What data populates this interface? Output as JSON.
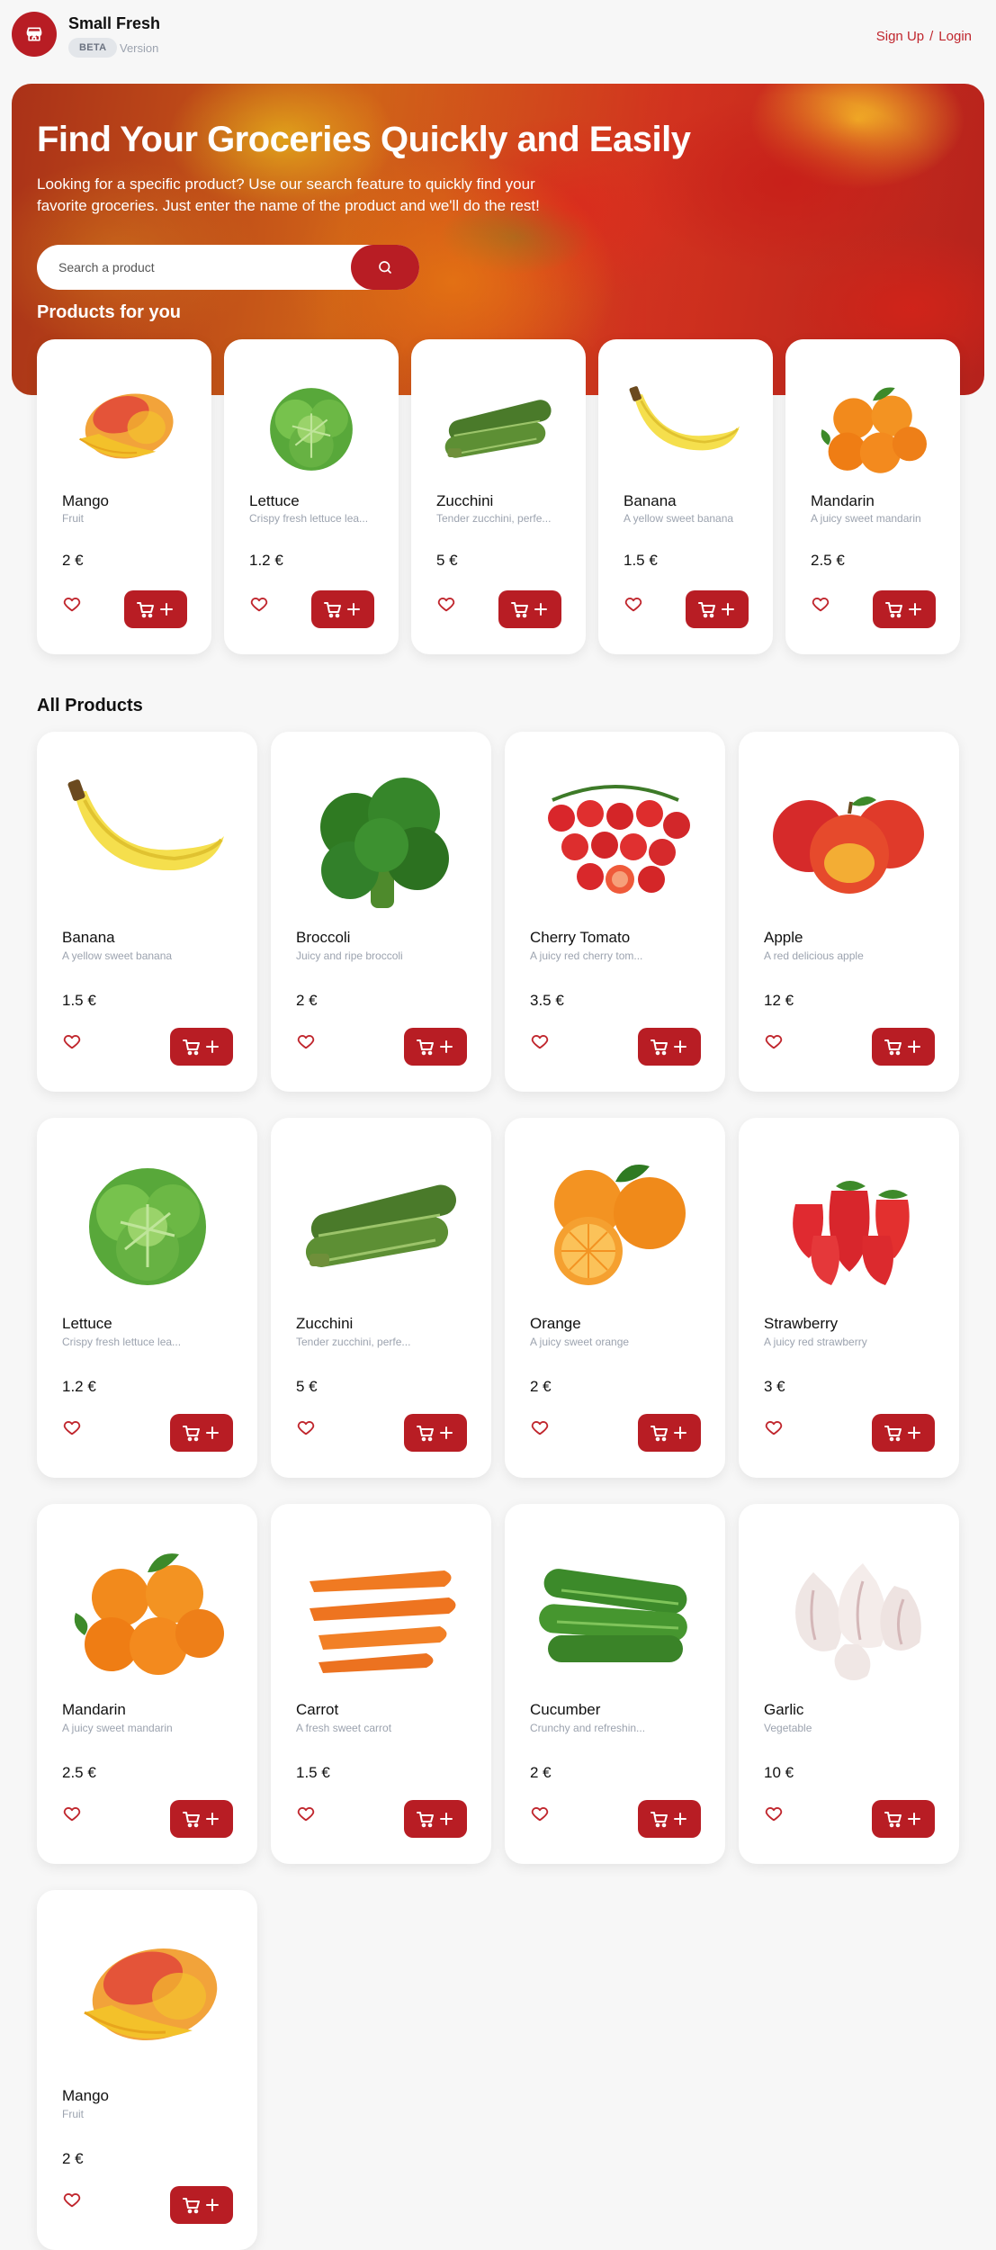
{
  "header": {
    "brand": "Small Fresh",
    "badge": "BETA",
    "version": "Version",
    "signup": "Sign Up",
    "separator": "/",
    "login": "Login"
  },
  "hero": {
    "title": "Find Your Groceries Quickly and Easily",
    "subtitle": "Looking for a specific product? Use our search feature to quickly find your favorite groceries. Just enter the name of the product and we'll do the rest!",
    "search_placeholder": "Search a product"
  },
  "for_you": {
    "title": "Products for you",
    "items": [
      {
        "name": "Mango",
        "desc": "Fruit",
        "price": "2 €",
        "icon": "mango"
      },
      {
        "name": "Lettuce",
        "desc": "Crispy fresh lettuce lea...",
        "price": "1.2 €",
        "icon": "lettuce"
      },
      {
        "name": "Zucchini",
        "desc": "Tender zucchini, perfe...",
        "price": "5 €",
        "icon": "zucchini"
      },
      {
        "name": "Banana",
        "desc": "A yellow sweet banana",
        "price": "1.5 €",
        "icon": "banana"
      },
      {
        "name": "Mandarin",
        "desc": "A juicy sweet mandarin",
        "price": "2.5 €",
        "icon": "mandarin"
      }
    ]
  },
  "all_products": {
    "title": "All Products",
    "items": [
      {
        "name": "Banana",
        "desc": "A yellow sweet banana",
        "price": "1.5 €",
        "icon": "banana"
      },
      {
        "name": "Broccoli",
        "desc": "Juicy and ripe broccoli",
        "price": "2 €",
        "icon": "broccoli"
      },
      {
        "name": "Cherry Tomato",
        "desc": "A juicy red cherry tom...",
        "price": "3.5 €",
        "icon": "cherry-tomato"
      },
      {
        "name": "Apple",
        "desc": "A red delicious apple",
        "price": "12 €",
        "icon": "apple"
      },
      {
        "name": "Lettuce",
        "desc": "Crispy fresh lettuce lea...",
        "price": "1.2 €",
        "icon": "lettuce"
      },
      {
        "name": "Zucchini",
        "desc": "Tender zucchini, perfe...",
        "price": "5 €",
        "icon": "zucchini"
      },
      {
        "name": "Orange",
        "desc": "A juicy sweet orange",
        "price": "2 €",
        "icon": "orange"
      },
      {
        "name": "Strawberry",
        "desc": "A juicy red strawberry",
        "price": "3 €",
        "icon": "strawberry"
      },
      {
        "name": "Mandarin",
        "desc": "A juicy sweet mandarin",
        "price": "2.5 €",
        "icon": "mandarin"
      },
      {
        "name": "Carrot",
        "desc": "A fresh sweet carrot",
        "price": "1.5 €",
        "icon": "carrot"
      },
      {
        "name": "Cucumber",
        "desc": "Crunchy and refreshin...",
        "price": "2 €",
        "icon": "cucumber"
      },
      {
        "name": "Garlic",
        "desc": "Vegetable",
        "price": "10 €",
        "icon": "garlic"
      },
      {
        "name": "Mango",
        "desc": "Fruit",
        "price": "2 €",
        "icon": "mango"
      }
    ]
  },
  "colors": {
    "accent": "#b81d24",
    "link": "#c0262d",
    "background": "#f7f7f7"
  }
}
